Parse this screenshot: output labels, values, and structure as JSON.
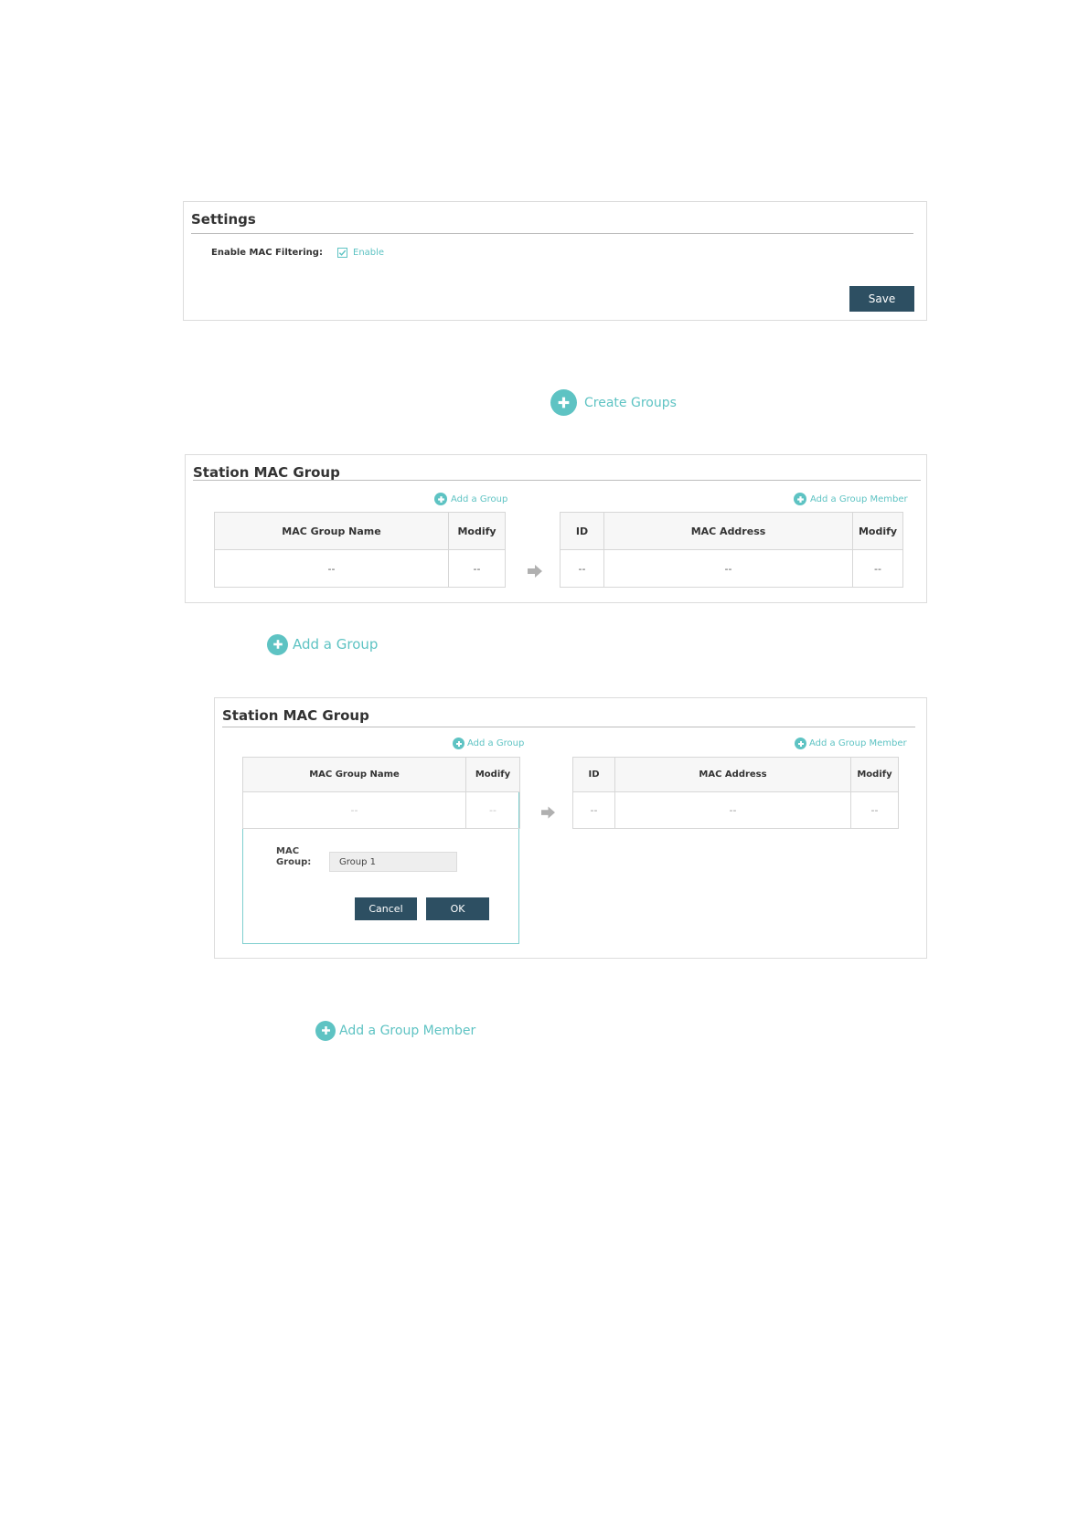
{
  "settings": {
    "title": "Settings",
    "mac_filter_label": "Enable MAC Filtering:",
    "enable_label": "Enable",
    "enabled": true,
    "save_label": "Save"
  },
  "create_groups": {
    "label": "Create Groups"
  },
  "station_group_1": {
    "title": "Station MAC Group",
    "add_group_label": "Add a Group",
    "add_member_label": "Add a Group Member",
    "group_table": {
      "headers": [
        "MAC Group Name",
        "Modify"
      ],
      "rows": [
        [
          "--",
          "--"
        ]
      ]
    },
    "member_table": {
      "headers": [
        "ID",
        "MAC Address",
        "Modify"
      ],
      "rows": [
        [
          "--",
          "--",
          "--"
        ]
      ]
    }
  },
  "add_group_callout": {
    "label": "Add a Group"
  },
  "station_group_2": {
    "title": "Station MAC Group",
    "add_group_label": "Add a Group",
    "add_member_label": "Add a Group Member",
    "group_table": {
      "headers": [
        "MAC Group Name",
        "Modify"
      ],
      "rows": [
        [
          "--",
          "--"
        ]
      ]
    },
    "member_table": {
      "headers": [
        "ID",
        "MAC Address",
        "Modify"
      ],
      "rows": [
        [
          "--",
          "--",
          "--"
        ]
      ]
    },
    "form": {
      "mac_group_label_line1": "MAC",
      "mac_group_label_line2": "Group:",
      "mac_group_value": "Group 1",
      "cancel_label": "Cancel",
      "ok_label": "OK"
    }
  },
  "add_member_callout": {
    "label": "Add a Group Member"
  },
  "colors": {
    "accent": "#5ec3c3",
    "button": "#2d4f62",
    "border": "#d7d7d7"
  },
  "icons": {
    "plus": "plus-circle-icon",
    "arrow": "arrow-right-icon",
    "check": "checkmark-icon"
  }
}
